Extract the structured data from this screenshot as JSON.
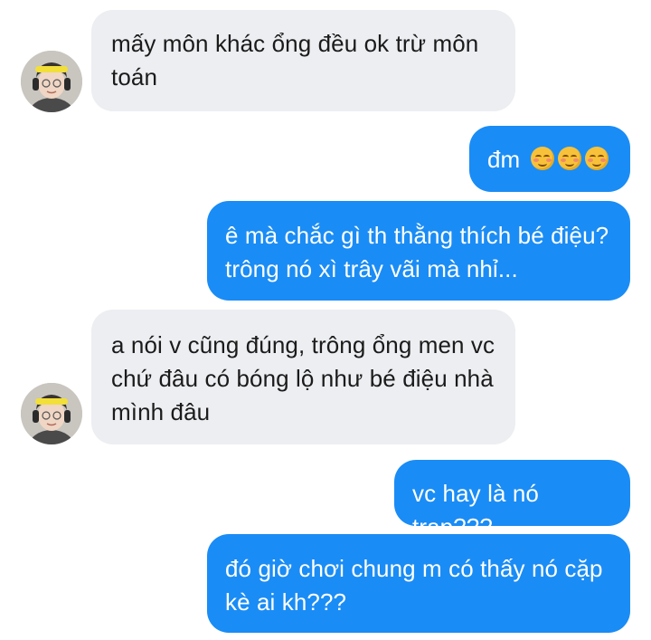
{
  "messages": [
    {
      "dir": "in",
      "lines": [
        "mấy môn khác ổng đều ok trừ môn",
        "toán"
      ]
    },
    {
      "dir": "out",
      "text": "đm",
      "emoji": [
        "smiling-face-icon",
        "smiling-face-icon",
        "smiling-face-icon"
      ]
    },
    {
      "dir": "out",
      "lines": [
        "ê mà chắc gì th thằng thích bé điệu?",
        "trông nó xì trây vãi mà nhỉ..."
      ]
    },
    {
      "dir": "in",
      "lines": [
        "a nói v cũng đúng, trông ổng men vc",
        "chứ đâu có bóng lộ như bé điệu nhà",
        "mình đâu"
      ]
    },
    {
      "dir": "out",
      "lines": [
        "vc hay là nó trap???"
      ]
    },
    {
      "dir": "out",
      "lines": [
        "đó giờ chơi chung m có thấy nó cặp",
        "kè ai kh???"
      ]
    }
  ],
  "colors": {
    "incoming_bubble": "#eceef1",
    "outgoing_bubble": "#1a8cf5",
    "incoming_text": "#1b1b1b",
    "outgoing_text": "#ffffff"
  }
}
